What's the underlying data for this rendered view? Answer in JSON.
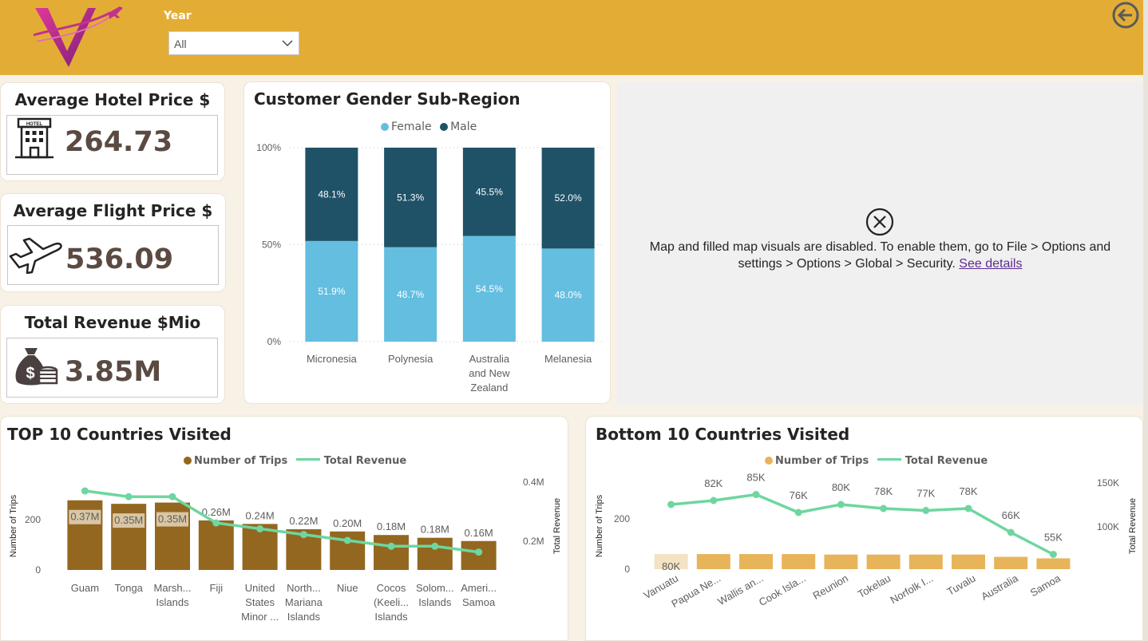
{
  "header": {
    "year_label": "Year",
    "year_value": "All",
    "back_icon": "back-arrow-icon",
    "logo_icon": "v-airplane-logo"
  },
  "kpis": {
    "hotel": {
      "title": "Average Hotel Price $",
      "value": "264.73",
      "icon": "hotel-icon"
    },
    "flight": {
      "title": "Average Flight Price $",
      "value": "536.09",
      "icon": "airplane-icon"
    },
    "revenue": {
      "title": "Total Revenue $Mio",
      "value": "3.85M",
      "icon": "money-bag-icon"
    }
  },
  "map": {
    "message_line1": "Map and filled map visuals are disabled. To enable them, go to File > Options and",
    "message_line2": "settings > Options > Global > Security.",
    "link_text": "See details",
    "icon": "close-circle-icon"
  },
  "colors": {
    "header": "#e3ad35",
    "female": "#63bee0",
    "male": "#1f5267",
    "trips_top": "#936720",
    "trips_bottom": "#e8b45a",
    "revenue_line": "#6ed6a0"
  },
  "chart_data": [
    {
      "id": "gender",
      "type": "bar",
      "stacked": "100%",
      "title": "Customer Gender Sub-Region",
      "legend": [
        "Female",
        "Male"
      ],
      "categories": [
        [
          "Micronesia"
        ],
        [
          "Polynesia"
        ],
        [
          "Australia",
          "and New",
          "Zealand"
        ],
        [
          "Melanesia"
        ]
      ],
      "series": [
        {
          "name": "Female",
          "values": [
            51.9,
            48.7,
            54.5,
            48.0
          ],
          "labels": [
            "51.9%",
            "48.7%",
            "54.5%",
            "48.0%"
          ]
        },
        {
          "name": "Male",
          "values": [
            48.1,
            51.3,
            45.5,
            52.0
          ],
          "labels": [
            "48.1%",
            "51.3%",
            "45.5%",
            "52.0%"
          ]
        }
      ],
      "y_ticks": [
        "100%",
        "50%",
        "0%"
      ],
      "ylim": [
        0,
        100
      ],
      "grid": true,
      "legend_position": "top-center"
    },
    {
      "id": "top10",
      "type": "bar",
      "combo": "bar-line",
      "title": "TOP 10 Countries Visited",
      "legend": [
        "Number of Trips",
        "Total Revenue"
      ],
      "categories": [
        [
          "Guam"
        ],
        [
          "Tonga"
        ],
        [
          "Marsh...",
          "Islands"
        ],
        [
          "Fiji"
        ],
        [
          "United",
          "States",
          "Minor ..."
        ],
        [
          "North...",
          "Mariana",
          "Islands"
        ],
        [
          "Niue"
        ],
        [
          "Cocos",
          "(Keeli...",
          "Islands"
        ],
        [
          "Solom...",
          "Islands"
        ],
        [
          "Ameri...",
          "Samoa"
        ]
      ],
      "series": [
        {
          "name": "Number of Trips",
          "axis": "left",
          "values": [
            277,
            263,
            268,
            197,
            183,
            162,
            153,
            139,
            128,
            115
          ]
        },
        {
          "name": "Total Revenue",
          "axis": "right",
          "values": [
            0.37,
            0.35,
            0.35,
            0.26,
            0.24,
            0.22,
            0.2,
            0.18,
            0.18,
            0.16
          ],
          "labels": [
            "0.37M",
            "0.35M",
            "0.35M",
            "0.26M",
            "0.24M",
            "0.22M",
            "0.20M",
            "0.18M",
            "0.18M",
            "0.16M"
          ]
        }
      ],
      "ylabel": "Number of Trips",
      "y2label": "Total Revenue",
      "y_ticks": [
        "200",
        "0"
      ],
      "y2_ticks": [
        "0.4M",
        "0.2M"
      ],
      "ylim": [
        0,
        300
      ],
      "y2lim": [
        0,
        0.4
      ],
      "legend_position": "top-center"
    },
    {
      "id": "bottom10",
      "type": "bar",
      "combo": "bar-line",
      "title": "Bottom 10 Countries Visited",
      "legend": [
        "Number of Trips",
        "Total Revenue"
      ],
      "categories": [
        "Vanuatu",
        "Papua Ne...",
        "Wallis an...",
        "Cook Isla...",
        "Reunion",
        "Tokelau",
        "Norfolk I...",
        "Tuvalu",
        "Australia",
        "Samoa"
      ],
      "series": [
        {
          "name": "Number of Trips",
          "axis": "left",
          "values": [
            60,
            60,
            60,
            60,
            58,
            58,
            58,
            58,
            49,
            43
          ]
        },
        {
          "name": "Total Revenue",
          "axis": "right",
          "values": [
            80,
            82,
            85,
            76,
            80,
            78,
            77,
            78,
            66,
            55
          ],
          "labels": [
            "80K",
            "82K",
            "85K",
            "76K",
            "80K",
            "78K",
            "77K",
            "78K",
            "66K",
            "55K"
          ]
        }
      ],
      "ylabel": "Number of Trips",
      "y2label": "Total Revenue",
      "y_ticks": [
        "200",
        "0"
      ],
      "y2_ticks": [
        "150K",
        "100K"
      ],
      "ylim": [
        0,
        300
      ],
      "y2lim": [
        0,
        150
      ],
      "legend_position": "top-center"
    }
  ]
}
